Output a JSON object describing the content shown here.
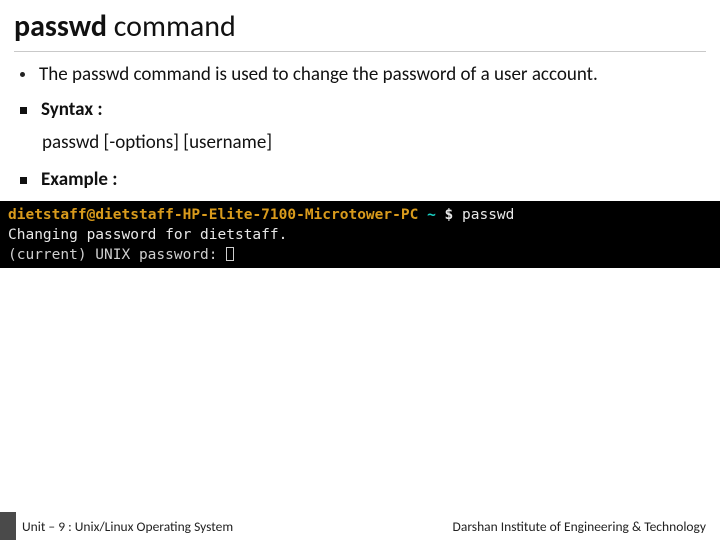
{
  "title": {
    "bold": "passwd",
    "rest": " command"
  },
  "bullets": {
    "description": "The passwd command is used to change the password of a user account.",
    "syntax_label": "Syntax :",
    "syntax_text": "passwd [-options] [username]",
    "example_label": "Example :"
  },
  "terminal": {
    "user": "dietstaff",
    "at": "@",
    "host": "dietstaff-HP-Elite-7100-Microtower-PC",
    "sep": " ",
    "tilde": "~",
    "prompt": " $ ",
    "cmd": "passwd",
    "line2": "Changing password for dietstaff.",
    "line3": "(current) UNIX password: "
  },
  "footer": {
    "unit": "Unit – 9  : Unix/Linux Operating System",
    "institute": "Darshan Institute of Engineering & Technology"
  }
}
